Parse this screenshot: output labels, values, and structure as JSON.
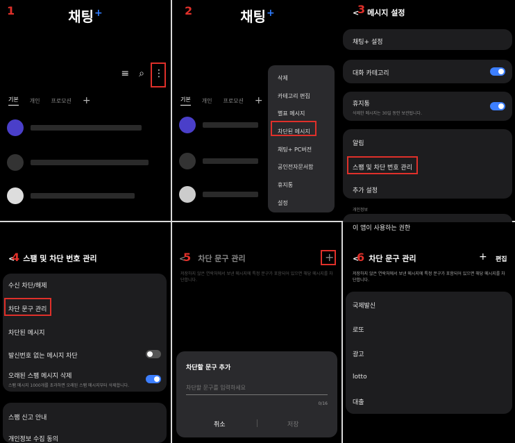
{
  "steps": [
    "1",
    "2",
    "3",
    "4",
    "5",
    "6"
  ],
  "p1": {
    "title": "채팅",
    "title_plus": "+",
    "tabs": [
      "기본",
      "개인",
      "프로모션"
    ],
    "add_tab": "+",
    "icons": [
      "sort-icon",
      "search-icon",
      "more-icon"
    ]
  },
  "p2": {
    "title": "채팅",
    "title_plus": "+",
    "tabs": [
      "기본",
      "개인",
      "프로모션"
    ],
    "add_tab": "+",
    "menu": [
      "삭제",
      "카테고리 편집",
      "별표 메시지",
      "차단된 메시지",
      "채팅+ PC버전",
      "공인전자문서함",
      "휴지통",
      "설정"
    ]
  },
  "p3": {
    "back": "<",
    "title": "메시지 설정",
    "chat_plus": "채팅+ 설정",
    "conv_category": "대화 카테고리",
    "trash": "휴지통",
    "trash_sub": "삭제한 메시지는 30일 동안 보관됩니다.",
    "notifications": "알림",
    "spam": "스팸 및 차단 번호 관리",
    "more": "추가 설정",
    "privacy_label": "개인정보",
    "permissions": "이 앱이 사용하는 권한"
  },
  "p4": {
    "back": "<",
    "title": "스팸 및 차단 번호 관리",
    "items": [
      "수신 차단/해제",
      "차단 문구 관리",
      "차단된 메시지",
      "발신번호 없는 메시지 차단",
      "오래된 스팸 메시지 삭제"
    ],
    "old_spam_sub": "스팸 메시지 1000개를 초과하면 오래된 스팸 메시지부터 삭제합니다.",
    "report": "스팸 신고 안내",
    "consent": "개인정보 수집 동의"
  },
  "p5": {
    "back": "<",
    "title": "차단 문구 관리",
    "add_icon": "+",
    "desc": "저장하지 않은 연락처에서 보낸 메시지에 특정 문구가 포함되어 있으면 해당 메시지를 차단합니다.",
    "dialog_title": "차단할 문구 추가",
    "placeholder": "차단할 문구를 입력하세요",
    "counter": "0/16",
    "cancel": "취소",
    "save": "저장"
  },
  "p6": {
    "back": "<",
    "title": "차단 문구 관리",
    "add_icon": "+",
    "edit": "편집",
    "desc": "저장하지 않은 연락처에서 보낸 메시지에 특정 문구가 포함되어 있으면 해당 메시지를 차단합니다.",
    "phrases": [
      "국제발신",
      "로또",
      "광고",
      "lotto",
      "대출"
    ]
  }
}
